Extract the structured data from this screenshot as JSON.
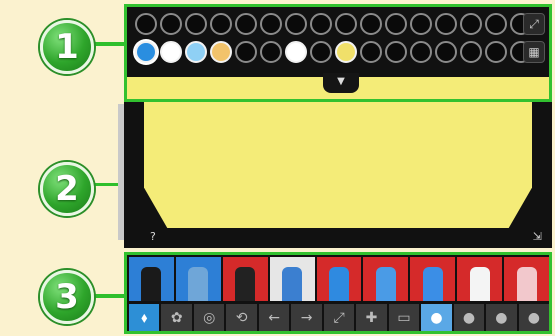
{
  "callouts": [
    "1",
    "2",
    "3"
  ],
  "palette": {
    "row1": [
      "empty",
      "empty",
      "empty",
      "empty",
      "empty",
      "empty",
      "empty",
      "empty",
      "empty",
      "empty",
      "empty",
      "empty",
      "empty",
      "empty",
      "empty",
      "empty"
    ],
    "row2": [
      "#2a8ee0",
      "#ffffff",
      "#8fd0f5",
      "#f2c36b",
      "empty",
      "empty",
      "#ffffff",
      "empty",
      "#f0e06a",
      "empty",
      "empty",
      "empty",
      "empty",
      "empty",
      "empty",
      "empty"
    ],
    "side_buttons": [
      "expand-icon",
      "grid-icon"
    ]
  },
  "canvas": {
    "color": "#f4ec78",
    "help_glyph": "?",
    "resize_glyph": "⇲"
  },
  "tools": {
    "items": [
      {
        "name": "marker-black",
        "color": "blue"
      },
      {
        "name": "eraser-block",
        "color": "blue"
      },
      {
        "name": "brush-dark",
        "color": "red"
      },
      {
        "name": "pencil-blue",
        "color": "white"
      },
      {
        "name": "spray-blue",
        "color": "red"
      },
      {
        "name": "marker-blue",
        "color": "red"
      },
      {
        "name": "pen-blue",
        "color": "red"
      },
      {
        "name": "pen-white",
        "color": "red"
      },
      {
        "name": "eraser-pink",
        "color": "red"
      }
    ],
    "actions": [
      "⬧",
      "✿",
      "◎",
      "⟲",
      "←",
      "→",
      "⤢",
      "✚",
      "▭",
      "●",
      "●",
      "●",
      "●"
    ]
  }
}
